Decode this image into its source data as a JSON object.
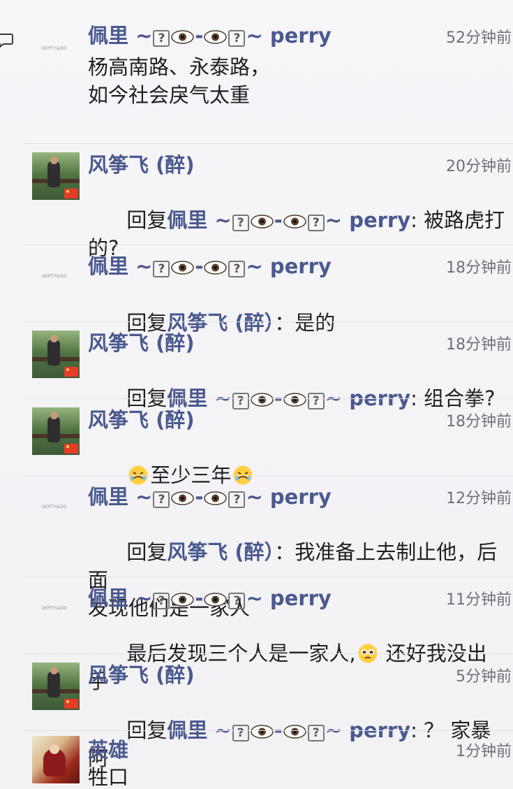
{
  "comments": [
    {
      "author": "佩里 ~",
      "author_suffix": "perry",
      "time": "52分钟前",
      "content": "杨高南路、永泰路，\n如今社会戾气太重",
      "avatar_label": "DEPTY&DO"
    },
    {
      "author": "风筝飞 (醉)",
      "time": "20分钟前",
      "reply_prefix": "回复",
      "reply_target": "佩里 ~",
      "reply_target_suffix": "perry",
      "reply_colon": ":",
      "content": " 被路虎打\n的?"
    },
    {
      "author": "佩里 ~",
      "author_suffix": "perry",
      "time": "18分钟前",
      "reply_prefix": "回复",
      "reply_target": "风筝飞 (醉）",
      "reply_colon": "：",
      "content": "是的",
      "avatar_label": "DEPTY&DO"
    },
    {
      "author": "风筝飞 (醉)",
      "time": "18分钟前",
      "reply_prefix": "回复",
      "reply_target": "佩里 ~",
      "reply_target_suffix": "perry",
      "reply_colon": ":",
      "content": " 组合拳?"
    },
    {
      "author": "风筝飞 (醉)",
      "time": "18分钟前",
      "content": "至少三年"
    },
    {
      "author": "佩里 ~",
      "author_suffix": "perry",
      "time": "12分钟前",
      "reply_prefix": "回复",
      "reply_target": "风筝飞 (醉）",
      "reply_colon": "：",
      "content": "我准备上去制止他，后面\n发现他们是一家人",
      "avatar_label": "DEPTY&DO"
    },
    {
      "author": "佩里 ~",
      "author_suffix": "perry",
      "time": "11分钟前",
      "content_before": "最后发现三个人是一家人,",
      "content_after": " 还好我没出手",
      "avatar_label": "DEPTY&DO"
    },
    {
      "author": "风筝飞 (醉)",
      "time": "5分钟前",
      "reply_prefix": "回复",
      "reply_target": "佩里 ~",
      "reply_target_suffix": "perry",
      "reply_colon": ":",
      "content": " ？ 家暴阿"
    },
    {
      "author": "英雄",
      "time": "1分钟前",
      "content": "牲口"
    }
  ],
  "icons": {
    "edge_icon": "comment-bubble-icon",
    "question_box": "?",
    "eye": "eye-emoji-icon",
    "weary_face": "weary-face-emoji-icon",
    "pleading_face": "pleading-face-emoji-icon"
  },
  "colors": {
    "name": "#4a5a8f",
    "text": "#1f1f23",
    "time": "#6f6f78",
    "background": "#f4f3f6",
    "divider": "#e2e1e6"
  }
}
